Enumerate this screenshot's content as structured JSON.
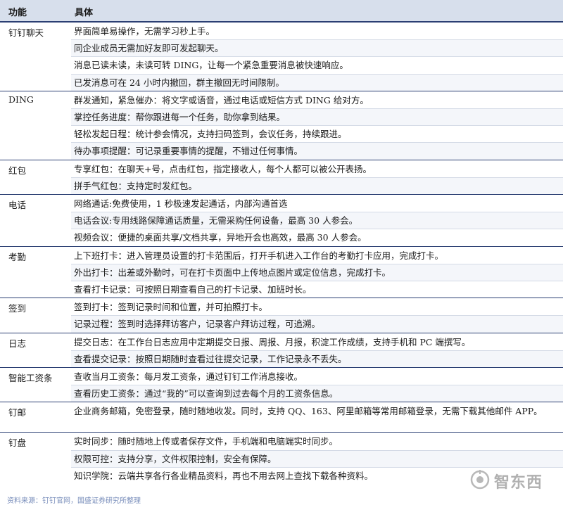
{
  "header": {
    "col1": "功能",
    "col2": "具体"
  },
  "groups": [
    {
      "label": "钉钉聊天",
      "items": [
        "界面简单易操作，无需学习秒上手。",
        "同企业成员无需加好友即可发起聊天。",
        "消息已读未读，未读可转 DING，让每一个紧急重要消息被快速响应。",
        "已发消息可在 24 小时内撤回，群主撤回无时间限制。"
      ]
    },
    {
      "label": "DING",
      "items": [
        "群发通知，紧急催办：将文字或语音，通过电话或短信方式 DING 给对方。",
        "掌控任务进度：帮你跟进每一个任务，助你拿到结果。",
        "轻松发起日程：统计参会情况，支持扫码签到，会议任务，持续跟进。",
        "待办事项提醒：可记录重要事情的提醒，不错过任何事情。"
      ]
    },
    {
      "label": "红包",
      "items": [
        "专享红包：在聊天+号，点击红包，指定接收人，每个人都可以被公开表扬。",
        "拼手气红包：支持定时发红包。"
      ]
    },
    {
      "label": "电话",
      "items": [
        "网络通话:免费使用，1 秒极速发起通话，内部沟通首选",
        "电话会议:专用线路保障通话质量，无需采购任何设备，最高 30 人参会。",
        "视频会议：便捷的桌面共享/文档共享，异地开会也高效，最高 30 人参会。"
      ]
    },
    {
      "label": "考勤",
      "items": [
        "上下班打卡：进入管理员设置的打卡范围后，打开手机进入工作台的考勤打卡应用，完成打卡。",
        "外出打卡：出差或外勤时，可在打卡页面中上传地点图片或定位信息，完成打卡。",
        "查看打卡记录：可按照日期查看自己的打卡记录、加班时长。"
      ]
    },
    {
      "label": "签到",
      "items": [
        "签到打卡：签到记录时间和位置，并可拍照打卡。",
        "记录过程：签到时选择拜访客户，记录客户拜访过程，可追溯。"
      ]
    },
    {
      "label": "日志",
      "items": [
        "提交日志：在工作台日志应用中定期提交日报、周报、月报，积淀工作成绩，支持手机和 PC 端撰写。",
        "查看提交记录：按照日期随时查看过往提交记录，工作记录永不丢失。"
      ]
    },
    {
      "label": "智能工资条",
      "items": [
        "查收当月工资条：每月发工资条，通过钉钉工作消息接收。",
        "查看历史工资条：通过“我的”可以查询到过去每个月的工资条信息。"
      ]
    },
    {
      "label": "钉邮",
      "items": [
        "企业商务邮箱，免密登录，随时随地收发。同时，支持 QQ、163、阿里邮箱等常用邮箱登录，无需下载其他邮件 APP。"
      ]
    },
    {
      "label": "钉盘",
      "items": [
        "实时同步：随时随地上传或者保存文件，手机端和电脑端实时同步。",
        "权限可控：支持分享，文件权限控制，安全有保障。",
        "知识学院：云端共享各行各业精品资料，再也不用去网上查找下载各种资料。"
      ]
    }
  ],
  "footer": {
    "source": "资料来源：钉钉官网，国盛证券研究所整理"
  },
  "watermark": {
    "text": "智东西"
  }
}
